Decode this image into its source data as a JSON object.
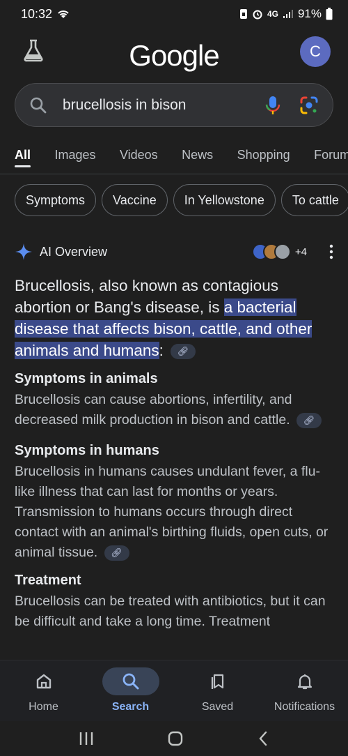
{
  "status": {
    "time": "10:32",
    "network": "4G",
    "battery": "91%"
  },
  "header": {
    "logo": "Google",
    "avatar_letter": "C"
  },
  "search": {
    "query": "brucellosis in bison"
  },
  "tabs": [
    {
      "label": "All",
      "active": true
    },
    {
      "label": "Images"
    },
    {
      "label": "Videos"
    },
    {
      "label": "News"
    },
    {
      "label": "Shopping"
    },
    {
      "label": "Forum"
    }
  ],
  "chips": [
    "Symptoms",
    "Vaccine",
    "In Yellowstone",
    "To cattle"
  ],
  "ai_overview": {
    "title": "AI Overview",
    "source_count": "+4",
    "lead_prefix": "Brucellosis, also known as contagious abortion or Bang's disease, is ",
    "lead_highlight": "a bacterial disease that affects bison, cattle, and other animals and humans",
    "lead_suffix": ":",
    "sections": [
      {
        "heading": "Symptoms in animals",
        "text": "Brucellosis can cause abortions, infertility, and decreased milk production in bison and cattle."
      },
      {
        "heading": "Symptoms in humans",
        "text": "Brucellosis in humans causes undulant fever, a flu-like illness that can last for months or years. Transmission to humans occurs through direct contact with an animal's birthing fluids, open cuts, or animal tissue."
      },
      {
        "heading": "Treatment",
        "text": "Brucellosis can be treated with antibiotics, but it can be difficult and take a long time. Treatment"
      }
    ]
  },
  "bottom_nav": [
    {
      "label": "Home",
      "icon": "home-icon"
    },
    {
      "label": "Search",
      "icon": "search-icon",
      "active": true
    },
    {
      "label": "Saved",
      "icon": "bookmark-icon"
    },
    {
      "label": "Notifications",
      "icon": "bell-icon"
    }
  ]
}
